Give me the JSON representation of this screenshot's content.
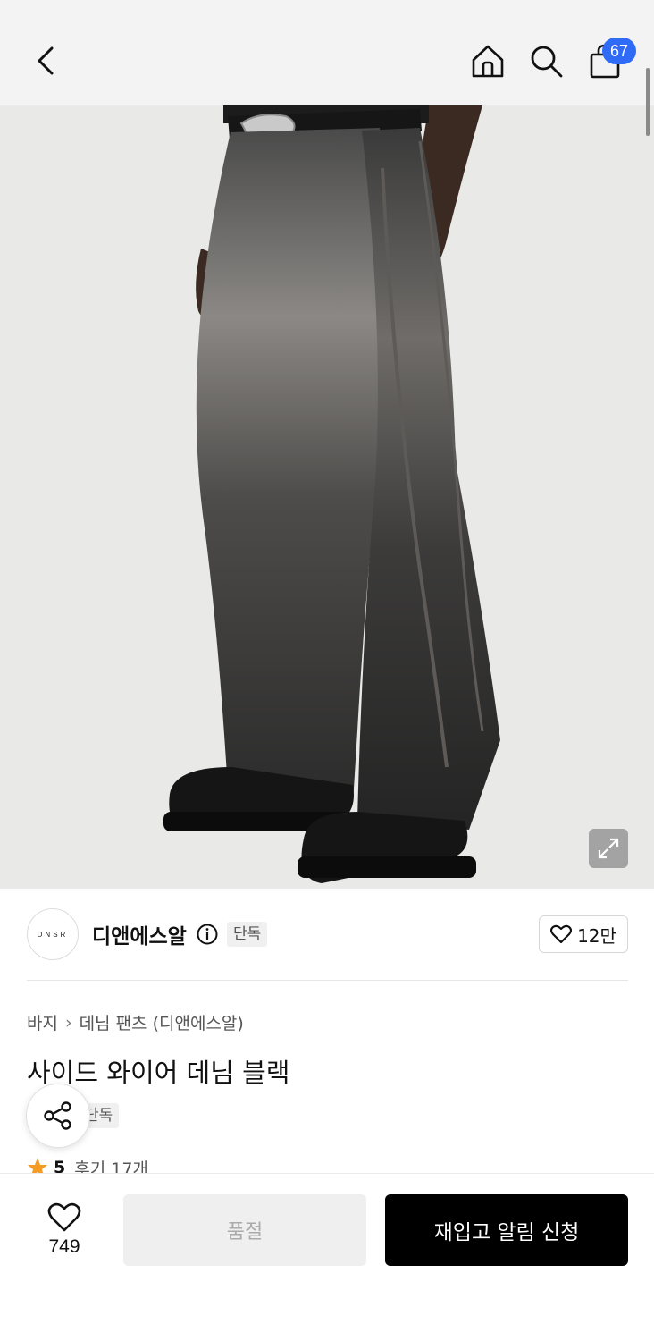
{
  "header": {
    "cart_count": "67",
    "icons": [
      "back-icon",
      "home-icon",
      "search-icon",
      "bag-icon"
    ]
  },
  "hero": {
    "alt": "",
    "expand_icon": "expand-icon",
    "colors": {
      "background": "#e9e9e7",
      "denim": "#2f2f2f",
      "denim_fade": "#8a8784"
    }
  },
  "brand": {
    "logo_text": "DNSR",
    "name": "디앤에스알",
    "exclusive_tag": "단독",
    "like_count": "12만"
  },
  "product": {
    "breadcrumb": [
      "바지",
      "데님 팬츠 (디앤에스알)"
    ],
    "title": "사이드 와이어 데님 블랙",
    "exclusive_tag": "단독",
    "rating": "5",
    "review_label": "후기 17개"
  },
  "bottom_bar": {
    "wish_count": "749",
    "soldout_label": "품절",
    "restock_label": "재입고 알림 신청"
  },
  "colors": {
    "badge": "#2f6bf5",
    "star": "#f59a23",
    "primary_button": "#000000",
    "disabled_button": "#efefef"
  }
}
